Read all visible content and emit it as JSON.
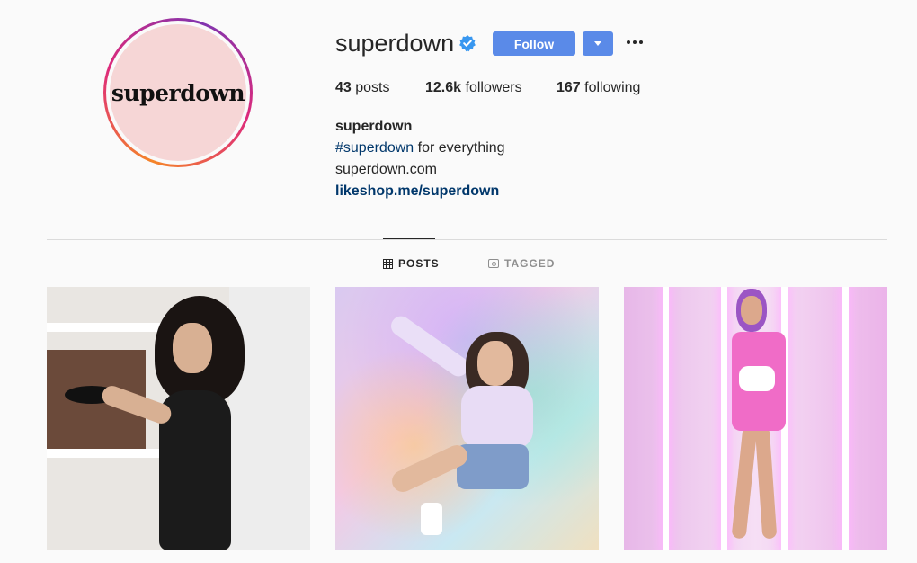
{
  "avatar": {
    "logo_text": "superdown"
  },
  "profile": {
    "username": "superdown",
    "verified_icon": "verified-badge-icon",
    "follow_label": "Follow",
    "stats": {
      "posts_count": "43",
      "posts_label": "posts",
      "followers_count": "12.6k",
      "followers_label": "followers",
      "following_count": "167",
      "following_label": "following"
    },
    "bio": {
      "name": "superdown",
      "hashtag": "#superdown",
      "tagline_rest": "for everything",
      "website_text": "superdown.com",
      "link": "likeshop.me/superdown"
    }
  },
  "tabs": [
    {
      "label": "POSTS",
      "icon": "grid-icon",
      "active": true
    },
    {
      "label": "TAGGED",
      "icon": "tag-icon",
      "active": false
    }
  ],
  "colors": {
    "accent": "#5a8ae8",
    "link": "#00376b",
    "text": "#262626",
    "muted": "#8e8e8e",
    "background": "#fafafa"
  }
}
